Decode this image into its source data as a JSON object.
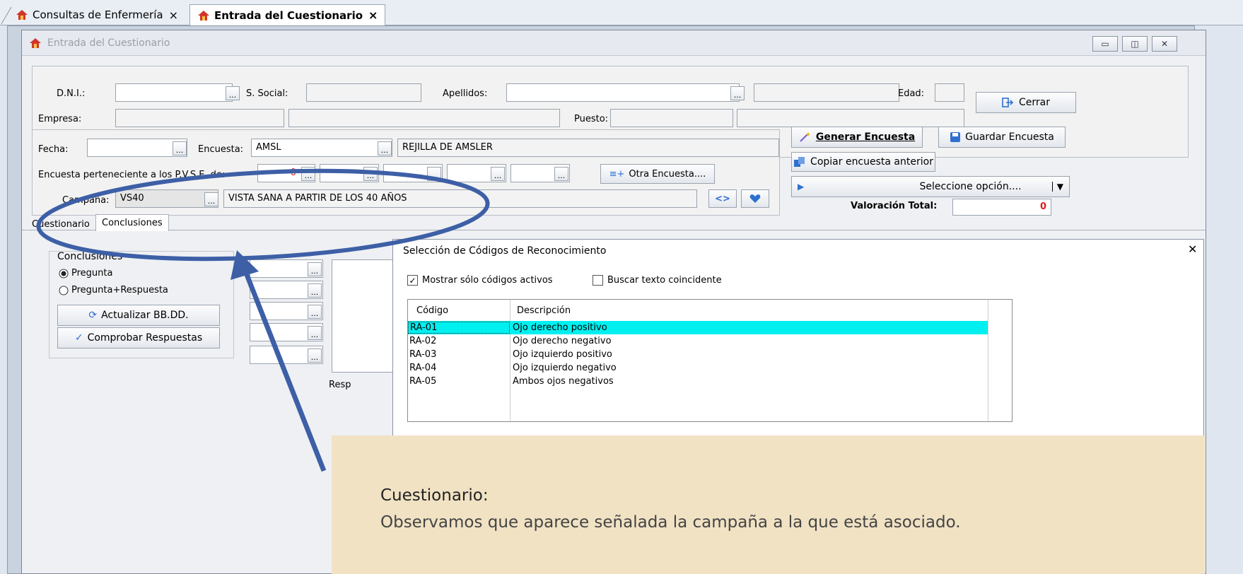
{
  "tabs": [
    {
      "label": "Consultas de Enfermería",
      "close": "×"
    },
    {
      "label": "Entrada del Cuestionario",
      "close": "×"
    }
  ],
  "window": {
    "title": "Entrada del Cuestionario",
    "buttons": {
      "minimize": "▭",
      "restore": "◫",
      "close": "✕"
    }
  },
  "patient": {
    "dni_label": "D.N.I.:",
    "dni_value": "",
    "ss_label": "S. Social:",
    "ss_value": "",
    "apellidos_label": "Apellidos:",
    "apellidos_value": "",
    "edad_label": "Edad:",
    "edad_value": "",
    "empresa_label": "Empresa:",
    "empresa_value": "",
    "puesto_label": "Puesto:",
    "puesto_value": "",
    "cerrar": "Cerrar"
  },
  "survey": {
    "fecha_label": "Fecha:",
    "fecha_value": "",
    "encuesta_label": "Encuesta:",
    "encuesta_code": "AMSL",
    "encuesta_desc": "REJILLA DE AMSLER",
    "pvse_label": "Encuesta perteneciente a los P.V.S.E. de:",
    "pvse_first": "0",
    "otra_encuesta": "Otra Encuesta....",
    "campana_label": "Campaña:",
    "campana_code": "VS40",
    "campana_desc": "VISTA SANA A PARTIR DE LOS 40 AÑOS",
    "nav_label": "<>"
  },
  "actions": {
    "generar": "Generar Encuesta",
    "guardar": "Guardar Encuesta",
    "copiar": "Copiar encuesta anterior",
    "seleccione": "Seleccione opción....",
    "valoracion_label": "Valoración Total:",
    "valoracion_value": "0"
  },
  "content_tabs": [
    "Cuestionario",
    "Conclusiones"
  ],
  "conclusiones": {
    "group_label": "Conclusiones",
    "radio1": "Pregunta",
    "radio2": "Pregunta+Respuesta",
    "actualizar": "Actualizar BB.DD.",
    "comprobar": "Comprobar Respuestas",
    "resp_label": "Resp"
  },
  "dialog": {
    "title": "Selección de Códigos de Reconocimiento",
    "close": "✕",
    "chk_activos": "Mostrar sólo códigos activos",
    "chk_texto": "Buscar texto coincidente",
    "columns": [
      "Código",
      "Descripción"
    ],
    "rows": [
      {
        "code": "RA-01",
        "desc": "Ojo derecho positivo"
      },
      {
        "code": "RA-02",
        "desc": "Ojo derecho negativo"
      },
      {
        "code": "RA-03",
        "desc": "Ojo izquierdo positivo"
      },
      {
        "code": "RA-04",
        "desc": "Ojo izquierdo negativo"
      },
      {
        "code": "RA-05",
        "desc": "Ambos ojos negativos"
      }
    ]
  },
  "annotation": {
    "heading": "Cuestionario:",
    "body": "Observamos que aparece señalada la campaña a la que está asociado."
  },
  "colors": {
    "highlight_row": "#00f0f0",
    "callout": "#3d5fa6",
    "accent_red": "#e01b1b",
    "note_bg": "#f1e2c4"
  }
}
